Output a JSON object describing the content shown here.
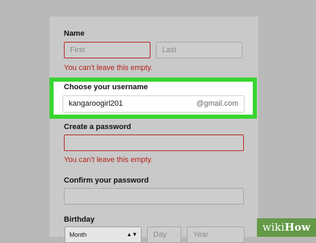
{
  "name": {
    "label": "Name",
    "first_placeholder": "First",
    "last_placeholder": "Last",
    "error": "You can't leave this empty."
  },
  "username": {
    "label": "Choose your username",
    "value": "kangaroogirl201",
    "suffix": "@gmail.com"
  },
  "password": {
    "label": "Create a password",
    "error": "You can't leave this empty."
  },
  "confirm_password": {
    "label": "Confirm your password"
  },
  "birthday": {
    "label": "Birthday",
    "month_placeholder": "Month",
    "day_placeholder": "Day",
    "year_placeholder": "Year"
  },
  "watermark": {
    "wiki": "wiki",
    "how": "How"
  },
  "colors": {
    "highlight": "#38d630",
    "error": "#b5221b"
  }
}
